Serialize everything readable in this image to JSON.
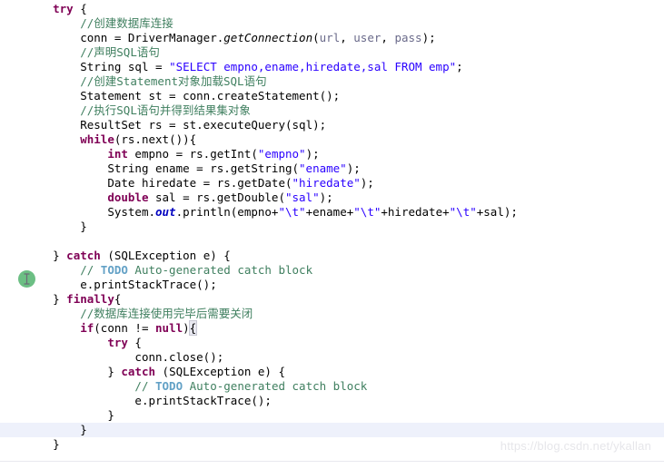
{
  "editor": {
    "language": "Java",
    "theme": {
      "background": "#ffffff",
      "foreground": "#000000",
      "keyword": "#7f0055",
      "string": "#2a00ff",
      "comment": "#3f7f5f",
      "todo_tag": "#63a1c6",
      "parameter": "#6a6a8a",
      "static_field": "#0000c0",
      "current_line_highlight": "#eef1fb",
      "bracket_match": "#e8e8f0",
      "marker_green": "#6cbf84"
    },
    "gutter_marker": {
      "name": "text-cursor-marker",
      "glyph": "I",
      "color": "#6cbf84"
    },
    "lines": [
      {
        "n": 1,
        "indent": 4,
        "highlight": false,
        "tokens": [
          {
            "t": "try",
            "c": "kw"
          },
          {
            "t": " {",
            "c": "plain"
          }
        ]
      },
      {
        "n": 2,
        "indent": 8,
        "highlight": false,
        "tokens": [
          {
            "t": "//创建数据库连接",
            "c": "cmt"
          }
        ]
      },
      {
        "n": 3,
        "indent": 8,
        "highlight": false,
        "tokens": [
          {
            "t": "conn = DriverManager.",
            "c": "plain"
          },
          {
            "t": "getConnection",
            "c": "stat"
          },
          {
            "t": "(",
            "c": "plain"
          },
          {
            "t": "url",
            "c": "param"
          },
          {
            "t": ", ",
            "c": "plain"
          },
          {
            "t": "user",
            "c": "param"
          },
          {
            "t": ", ",
            "c": "plain"
          },
          {
            "t": "pass",
            "c": "param"
          },
          {
            "t": ");",
            "c": "plain"
          }
        ]
      },
      {
        "n": 4,
        "indent": 8,
        "highlight": false,
        "tokens": [
          {
            "t": "//声明SQL语句",
            "c": "cmt"
          }
        ]
      },
      {
        "n": 5,
        "indent": 8,
        "highlight": false,
        "tokens": [
          {
            "t": "String sql = ",
            "c": "plain"
          },
          {
            "t": "\"SELECT empno,ename,hiredate,sal FROM emp\"",
            "c": "str"
          },
          {
            "t": ";",
            "c": "plain"
          }
        ]
      },
      {
        "n": 6,
        "indent": 8,
        "highlight": false,
        "tokens": [
          {
            "t": "//创建Statement对象加载SQL语句",
            "c": "cmt"
          }
        ]
      },
      {
        "n": 7,
        "indent": 8,
        "highlight": false,
        "tokens": [
          {
            "t": "Statement st = conn.createStatement();",
            "c": "plain"
          }
        ]
      },
      {
        "n": 8,
        "indent": 8,
        "highlight": false,
        "tokens": [
          {
            "t": "//执行SQL语句并得到结果集对象",
            "c": "cmt"
          }
        ]
      },
      {
        "n": 9,
        "indent": 8,
        "highlight": false,
        "tokens": [
          {
            "t": "ResultSet rs = st.executeQuery(sql);",
            "c": "plain"
          }
        ]
      },
      {
        "n": 10,
        "indent": 8,
        "highlight": false,
        "tokens": [
          {
            "t": "while",
            "c": "kw"
          },
          {
            "t": "(rs.next()){",
            "c": "plain"
          }
        ]
      },
      {
        "n": 11,
        "indent": 12,
        "highlight": false,
        "tokens": [
          {
            "t": "int",
            "c": "kw"
          },
          {
            "t": " empno = rs.getInt(",
            "c": "plain"
          },
          {
            "t": "\"empno\"",
            "c": "str"
          },
          {
            "t": ");",
            "c": "plain"
          }
        ]
      },
      {
        "n": 12,
        "indent": 12,
        "highlight": false,
        "tokens": [
          {
            "t": "String ename = rs.getString(",
            "c": "plain"
          },
          {
            "t": "\"ename\"",
            "c": "str"
          },
          {
            "t": ");",
            "c": "plain"
          }
        ]
      },
      {
        "n": 13,
        "indent": 12,
        "highlight": false,
        "tokens": [
          {
            "t": "Date hiredate = rs.getDate(",
            "c": "plain"
          },
          {
            "t": "\"hiredate\"",
            "c": "str"
          },
          {
            "t": ");",
            "c": "plain"
          }
        ]
      },
      {
        "n": 14,
        "indent": 12,
        "highlight": false,
        "tokens": [
          {
            "t": "double",
            "c": "kw"
          },
          {
            "t": " sal = rs.getDouble(",
            "c": "plain"
          },
          {
            "t": "\"sal\"",
            "c": "str"
          },
          {
            "t": ");",
            "c": "plain"
          }
        ]
      },
      {
        "n": 15,
        "indent": 12,
        "highlight": false,
        "tokens": [
          {
            "t": "System.",
            "c": "plain"
          },
          {
            "t": "out",
            "c": "statf"
          },
          {
            "t": ".println(empno+",
            "c": "plain"
          },
          {
            "t": "\"\\t\"",
            "c": "str"
          },
          {
            "t": "+ename+",
            "c": "plain"
          },
          {
            "t": "\"\\t\"",
            "c": "str"
          },
          {
            "t": "+hiredate+",
            "c": "plain"
          },
          {
            "t": "\"\\t\"",
            "c": "str"
          },
          {
            "t": "+sal);",
            "c": "plain"
          }
        ]
      },
      {
        "n": 16,
        "indent": 8,
        "highlight": false,
        "tokens": [
          {
            "t": "}",
            "c": "plain"
          }
        ]
      },
      {
        "n": 17,
        "indent": 0,
        "highlight": false,
        "tokens": []
      },
      {
        "n": 18,
        "indent": 4,
        "highlight": false,
        "tokens": [
          {
            "t": "} ",
            "c": "plain"
          },
          {
            "t": "catch",
            "c": "kw"
          },
          {
            "t": " (SQLException e) {",
            "c": "plain"
          }
        ]
      },
      {
        "n": 19,
        "indent": 8,
        "highlight": false,
        "tokens": [
          {
            "t": "// ",
            "c": "cmt"
          },
          {
            "t": "TODO",
            "c": "todo"
          },
          {
            "t": " Auto-generated catch block",
            "c": "cmt"
          }
        ]
      },
      {
        "n": 20,
        "indent": 8,
        "highlight": false,
        "tokens": [
          {
            "t": "e.printStackTrace();",
            "c": "plain"
          }
        ]
      },
      {
        "n": 21,
        "indent": 4,
        "highlight": false,
        "tokens": [
          {
            "t": "} ",
            "c": "plain"
          },
          {
            "t": "finally",
            "c": "kw"
          },
          {
            "t": "{",
            "c": "plain"
          }
        ]
      },
      {
        "n": 22,
        "indent": 8,
        "highlight": false,
        "tokens": [
          {
            "t": "//数据库连接使用完毕后需要关闭",
            "c": "cmt"
          }
        ]
      },
      {
        "n": 23,
        "indent": 8,
        "highlight": false,
        "tokens": [
          {
            "t": "if",
            "c": "kw"
          },
          {
            "t": "(conn != ",
            "c": "plain"
          },
          {
            "t": "null",
            "c": "kw"
          },
          {
            "t": ")",
            "c": "plain"
          },
          {
            "t": "{",
            "c": "brk"
          }
        ]
      },
      {
        "n": 24,
        "indent": 12,
        "highlight": false,
        "tokens": [
          {
            "t": "try",
            "c": "kw"
          },
          {
            "t": " {",
            "c": "plain"
          }
        ]
      },
      {
        "n": 25,
        "indent": 16,
        "highlight": false,
        "tokens": [
          {
            "t": "conn.close();",
            "c": "plain"
          }
        ]
      },
      {
        "n": 26,
        "indent": 12,
        "highlight": false,
        "tokens": [
          {
            "t": "} ",
            "c": "plain"
          },
          {
            "t": "catch",
            "c": "kw"
          },
          {
            "t": " (SQLException e) {",
            "c": "plain"
          }
        ]
      },
      {
        "n": 27,
        "indent": 16,
        "highlight": false,
        "tokens": [
          {
            "t": "// ",
            "c": "cmt"
          },
          {
            "t": "TODO",
            "c": "todo"
          },
          {
            "t": " Auto-generated catch block",
            "c": "cmt"
          }
        ]
      },
      {
        "n": 28,
        "indent": 16,
        "highlight": false,
        "tokens": [
          {
            "t": "e.printStackTrace();",
            "c": "plain"
          }
        ]
      },
      {
        "n": 29,
        "indent": 12,
        "highlight": false,
        "tokens": [
          {
            "t": "}",
            "c": "plain"
          }
        ]
      },
      {
        "n": 30,
        "indent": 8,
        "highlight": true,
        "tokens": [
          {
            "t": "}",
            "c": "plain"
          }
        ]
      },
      {
        "n": 31,
        "indent": 4,
        "highlight": false,
        "tokens": [
          {
            "t": "}",
            "c": "plain"
          }
        ]
      }
    ]
  },
  "watermark": {
    "text": "https://blog.csdn.net/ykallan"
  }
}
